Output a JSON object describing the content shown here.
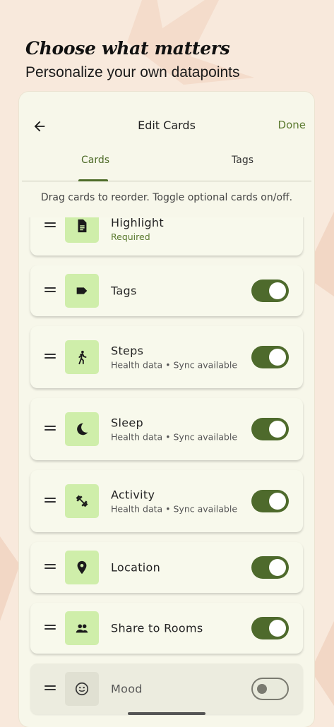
{
  "promo": {
    "headline": "Choose what matters",
    "subline": "Personalize your own datapoints"
  },
  "appbar": {
    "title": "Edit Cards",
    "done_label": "Done",
    "back_icon": "arrow-left-icon"
  },
  "tabs": [
    {
      "label": "Cards",
      "selected": true
    },
    {
      "label": "Tags",
      "selected": false
    }
  ],
  "hint": "Drag cards to reorder. Toggle optional cards on/off.",
  "cards": [
    {
      "title": "Highlight",
      "subtitle": "Required",
      "icon": "document-icon",
      "toggle": null
    },
    {
      "title": "Tags",
      "subtitle": "",
      "icon": "tag-icon",
      "toggle": "on"
    },
    {
      "title": "Steps",
      "subtitle": "Health data • Sync available",
      "icon": "walking-icon",
      "toggle": "on"
    },
    {
      "title": "Sleep",
      "subtitle": "Health data • Sync available",
      "icon": "moon-icon",
      "toggle": "on"
    },
    {
      "title": "Activity",
      "subtitle": "Health data • Sync available",
      "icon": "dumbbell-icon",
      "toggle": "on"
    },
    {
      "title": "Location",
      "subtitle": "",
      "icon": "location-pin-icon",
      "toggle": "on"
    },
    {
      "title": "Share to Rooms",
      "subtitle": "",
      "icon": "people-icon",
      "toggle": "on"
    },
    {
      "title": "Mood",
      "subtitle": "",
      "icon": "smiley-icon",
      "toggle": "off"
    }
  ],
  "colors": {
    "accent": "#4e6a2c",
    "accent_text": "#5b7a2f",
    "icon_bg": "#cfeeaa",
    "background": "#f8e9dc"
  }
}
